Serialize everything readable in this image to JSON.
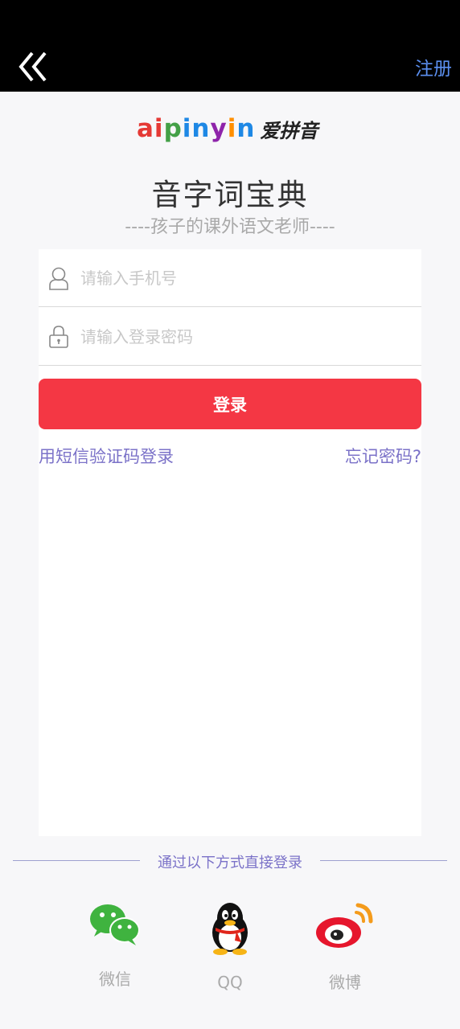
{
  "header": {
    "register_label": "注册"
  },
  "logo": {
    "latin": [
      "a",
      "i",
      "p",
      "i",
      "n",
      "y",
      "i",
      "n"
    ],
    "latin_colors": [
      "#e53935",
      "#e53935",
      "#43a047",
      "#1e88e5",
      "#1e88e5",
      "#8e24aa",
      "#ff8f00",
      "#1e88e5"
    ],
    "chinese": "爱拼音"
  },
  "app": {
    "title": "音字词宝典",
    "subtitle": "----孩子的课外语文老师----"
  },
  "form": {
    "phone_placeholder": "请输入手机号",
    "password_placeholder": "请输入登录密码",
    "login_label": "登录",
    "sms_login_label": "用短信验证码登录",
    "forgot_password_label": "忘记密码?"
  },
  "social": {
    "divider_text": "通过以下方式直接登录",
    "items": [
      {
        "label": "微信",
        "icon": "wechat-icon",
        "color": "#3fb33f"
      },
      {
        "label": "QQ",
        "icon": "qq-penguin-icon",
        "color": "#111111"
      },
      {
        "label": "微博",
        "icon": "weibo-icon",
        "color": "#e6162d"
      }
    ]
  },
  "colors": {
    "accent": "#f43744",
    "link": "#7b72c8",
    "register": "#5b8ff0"
  }
}
